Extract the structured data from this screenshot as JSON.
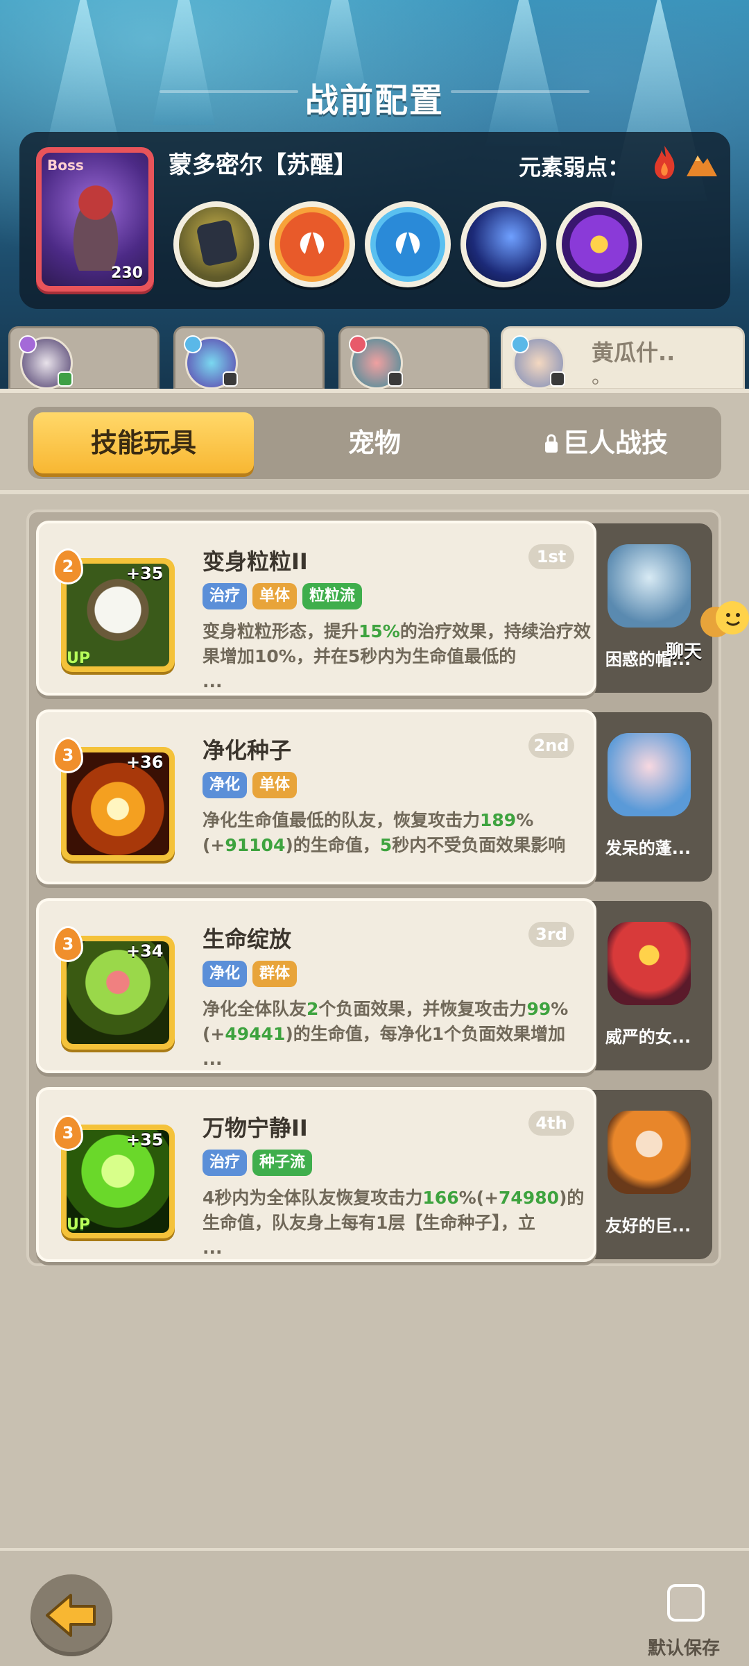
{
  "header": {
    "title": "战前配置",
    "boss": {
      "tag": "Boss",
      "level": "230",
      "name": "蒙多密尔【苏醒】",
      "weakness_label": "元素弱点：",
      "weakness_icons": [
        "fire-icon",
        "earth-icon"
      ],
      "skills": [
        "boss-skill-1",
        "boss-skill-2",
        "boss-skill-3",
        "boss-skill-4",
        "boss-skill-5"
      ]
    }
  },
  "characters": [
    {
      "name": "",
      "active": false
    },
    {
      "name": "",
      "active": false
    },
    {
      "name": "",
      "active": false
    },
    {
      "name": "黄瓜什..",
      "subtitle": "。",
      "active": true
    }
  ],
  "tabs": {
    "skill_toys": "技能玩具",
    "pets": "宠物",
    "giant_skills": "巨人战技"
  },
  "skills": [
    {
      "name": "变身粒粒II",
      "level": "2",
      "bonus": "+35",
      "up": "UP",
      "rank": "1st",
      "tags": [
        "治疗",
        "单体",
        "粒粒流"
      ],
      "desc": [
        "变身粒粒形态，提升",
        "15%",
        "的治疗效果，持续治疗效果增加10%，并在5秒内为生命值最低的",
        "..."
      ],
      "pet_name": "困惑的帽..."
    },
    {
      "name": "净化种子",
      "level": "3",
      "bonus": "+36",
      "rank": "2nd",
      "tags": [
        "净化",
        "单体"
      ],
      "desc": [
        "净化生命值最低的队友，恢复攻击力",
        "189",
        "%(+",
        "91104",
        ")的生命值，",
        "5",
        "秒内不受负面效果影响"
      ],
      "pet_name": "发呆的蓬..."
    },
    {
      "name": "生命绽放",
      "level": "3",
      "bonus": "+34",
      "rank": "3rd",
      "tags": [
        "净化",
        "群体"
      ],
      "desc": [
        "净化全体队友",
        "2",
        "个负面效果，并恢复攻击力",
        "99",
        "%(+",
        "49441",
        ")的生命值，每净化1个负面效果增加",
        "..."
      ],
      "pet_name": "威严的女..."
    },
    {
      "name": "万物宁静II",
      "level": "3",
      "bonus": "+35",
      "up": "UP",
      "rank": "4th",
      "tags": [
        "治疗",
        "种子流"
      ],
      "desc": [
        "4秒内为全体队友恢复攻击力",
        "166",
        "%(+",
        "74980",
        ")的生命值，队友身上每有1层【生命种子】，立",
        "..."
      ],
      "pet_name": "友好的巨..."
    }
  ],
  "chat": {
    "label": "聊天"
  },
  "footer": {
    "save_label": "默认保存"
  }
}
